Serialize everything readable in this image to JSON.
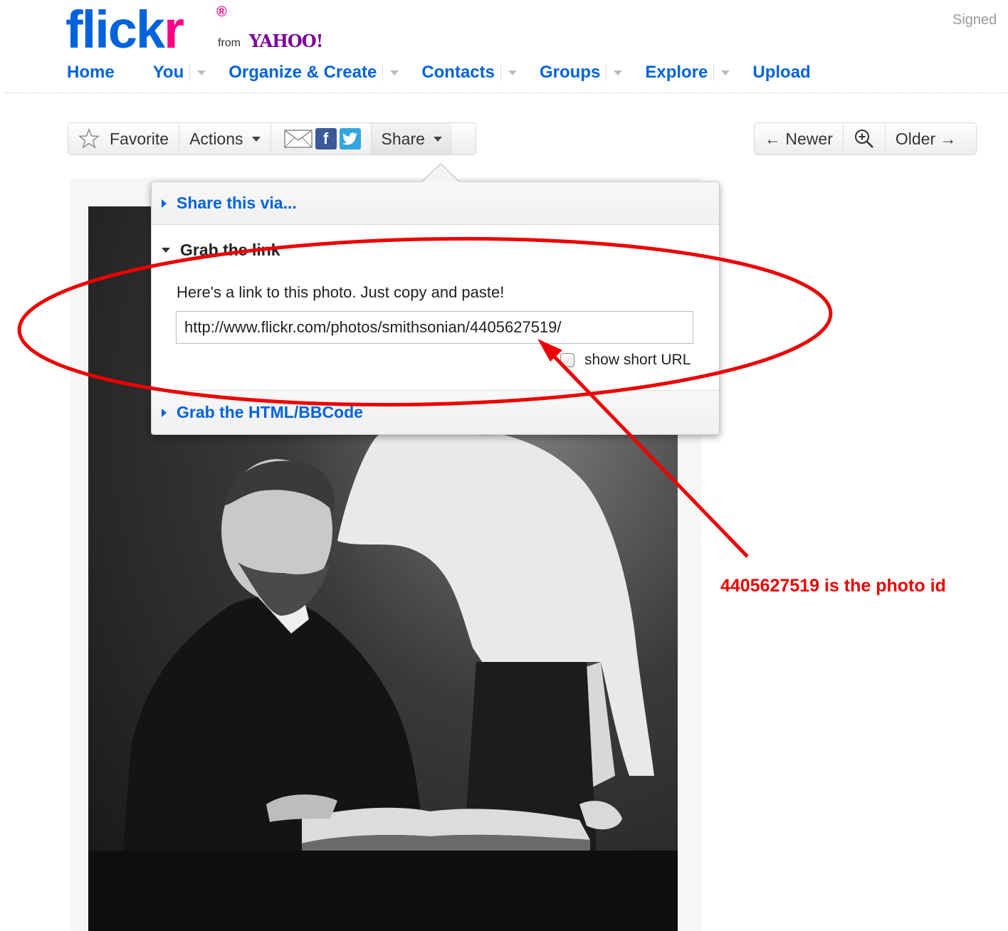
{
  "header": {
    "logo": {
      "flick": "flick",
      "r": "r",
      "reg": "®",
      "from": "from",
      "yahoo": "YAHOO!"
    },
    "signed": "Signed"
  },
  "nav": {
    "items": [
      {
        "label": "Home",
        "dropdown": false
      },
      {
        "label": "You",
        "dropdown": true
      },
      {
        "label": "Organize & Create",
        "dropdown": true
      },
      {
        "label": "Contacts",
        "dropdown": true
      },
      {
        "label": "Groups",
        "dropdown": true
      },
      {
        "label": "Explore",
        "dropdown": true
      },
      {
        "label": "Upload",
        "dropdown": false
      }
    ]
  },
  "toolbar": {
    "favorite": "Favorite",
    "actions": "Actions",
    "share": "Share",
    "facebook_letter": "f",
    "icons": [
      "star-icon",
      "mail-icon",
      "facebook-icon",
      "twitter-icon"
    ]
  },
  "photo_nav": {
    "newer": "← Newer",
    "older": "Older →",
    "zoom_icon": "zoom-in-icon"
  },
  "share_popup": {
    "share_via": "Share this via...",
    "grab_link": "Grab the link",
    "link_description": "Here's a link to this photo. Just copy and paste!",
    "url_value": "http://www.flickr.com/photos/smithsonian/4405627519/",
    "short_url_label": "show short URL",
    "short_url_checked": false,
    "grab_html": "Grab the HTML/BBCode"
  },
  "annotation": {
    "text": "4405627519 is the photo id",
    "color": "#ee0000"
  },
  "colors": {
    "link_blue": "#0063dc",
    "flickr_pink": "#ff0084",
    "yahoo_purple": "#7b0099"
  }
}
